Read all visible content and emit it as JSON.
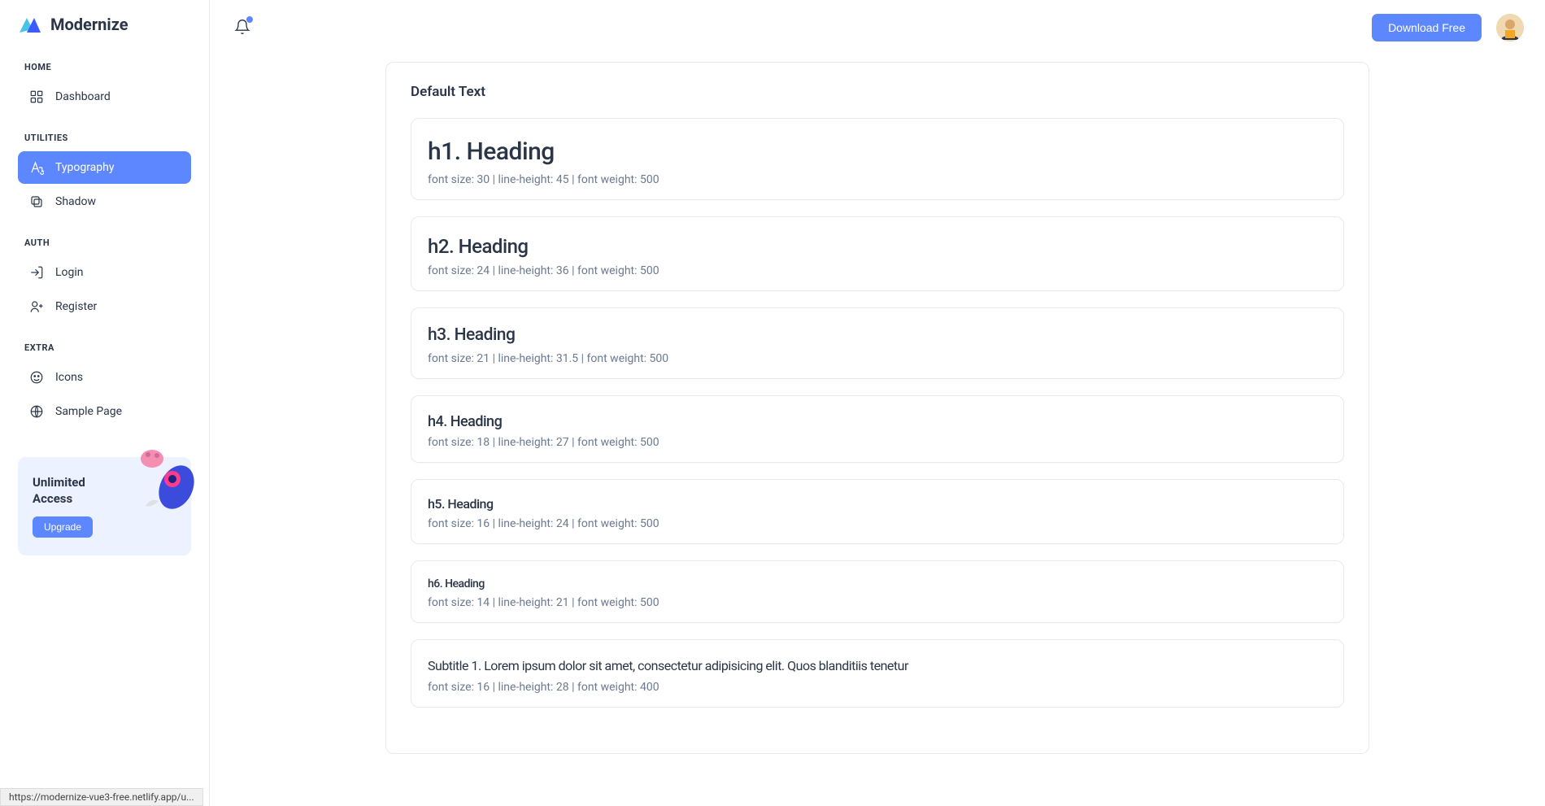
{
  "brand": {
    "name": "Modernize"
  },
  "sidebar": {
    "sections": [
      {
        "title": "HOME",
        "items": [
          {
            "label": "Dashboard",
            "icon": "dashboard-icon",
            "active": false
          }
        ]
      },
      {
        "title": "UTILITIES",
        "items": [
          {
            "label": "Typography",
            "icon": "typography-icon",
            "active": true
          },
          {
            "label": "Shadow",
            "icon": "shadow-icon",
            "active": false
          }
        ]
      },
      {
        "title": "AUTH",
        "items": [
          {
            "label": "Login",
            "icon": "login-icon",
            "active": false
          },
          {
            "label": "Register",
            "icon": "register-icon",
            "active": false
          }
        ]
      },
      {
        "title": "EXTRA",
        "items": [
          {
            "label": "Icons",
            "icon": "icons-icon",
            "active": false
          },
          {
            "label": "Sample Page",
            "icon": "sample-page-icon",
            "active": false
          }
        ]
      }
    ],
    "promo": {
      "title": "Unlimited Access",
      "button": "Upgrade"
    }
  },
  "topbar": {
    "download_label": "Download Free"
  },
  "page": {
    "title": "Default Text",
    "specs": [
      {
        "heading": "h1. Heading",
        "meta": "font size: 30 | line-height: 45 | font weight: 500",
        "size": 30,
        "lh": 45
      },
      {
        "heading": "h2. Heading",
        "meta": "font size: 24 | line-height: 36 | font weight: 500",
        "size": 24,
        "lh": 36
      },
      {
        "heading": "h3. Heading",
        "meta": "font size: 21 | line-height: 31.5 | font weight: 500",
        "size": 21,
        "lh": 31.5
      },
      {
        "heading": "h4. Heading",
        "meta": "font size: 18 | line-height: 27 | font weight: 500",
        "size": 18,
        "lh": 27
      },
      {
        "heading": "h5. Heading",
        "meta": "font size: 16 | line-height: 24 | font weight: 500",
        "size": 16,
        "lh": 24
      },
      {
        "heading": "h6. Heading",
        "meta": "font size: 14 | line-height: 21 | font weight: 500",
        "size": 14,
        "lh": 21
      },
      {
        "heading": "Subtitle 1. Lorem ipsum dolor sit amet, consectetur adipisicing elit. Quos blanditiis tenetur",
        "meta": "font size: 16 | line-height: 28 | font weight: 400",
        "size": 16,
        "lh": 28,
        "weight": 400
      }
    ]
  },
  "status": {
    "url": "https://modernize-vue3-free.netlify.app/u..."
  }
}
